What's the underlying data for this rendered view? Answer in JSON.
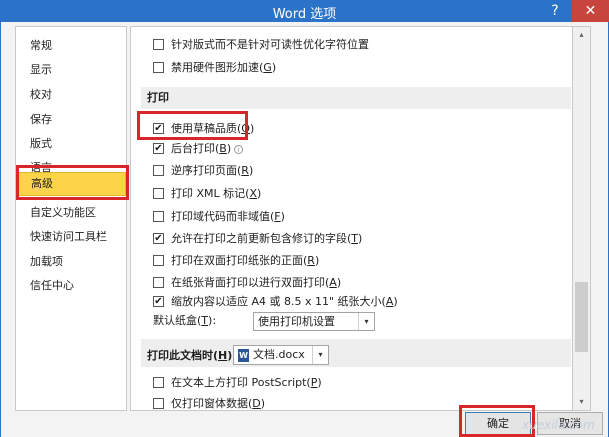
{
  "window": {
    "title": "Word 选项",
    "help_glyph": "?",
    "close_glyph": "✕"
  },
  "sidebar": {
    "items": [
      {
        "label": "常规"
      },
      {
        "label": "显示"
      },
      {
        "label": "校对"
      },
      {
        "label": "保存"
      },
      {
        "label": "版式"
      },
      {
        "label": "语言"
      },
      {
        "label": "高级",
        "selected": true
      },
      {
        "label": "自定义功能区"
      },
      {
        "label": "快速访问工具栏"
      },
      {
        "label": "加载项"
      },
      {
        "label": "信任中心"
      }
    ]
  },
  "options_top": [
    {
      "text": "针对版式而不是针对可读性优化字符位置",
      "checked": false
    },
    {
      "text": "禁用硬件图形加速(",
      "key": "G",
      "suffix": ")",
      "checked": false
    }
  ],
  "print_section": {
    "header": "打印",
    "options": [
      {
        "text": "使用草稿品质(",
        "key": "Q",
        "suffix": ")",
        "checked": true
      },
      {
        "text": "后台打印(",
        "key": "B",
        "suffix": ")",
        "checked": true,
        "info": true
      },
      {
        "text": "逆序打印页面(",
        "key": "R",
        "suffix": ")",
        "checked": false
      },
      {
        "text": "打印 XML 标记(",
        "key": "X",
        "suffix": ")",
        "checked": false
      },
      {
        "text": "打印域代码而非域值(",
        "key": "F",
        "suffix": ")",
        "checked": false
      },
      {
        "text": "允许在打印之前更新包含修订的字段(",
        "key": "T",
        "suffix": ")",
        "checked": true
      },
      {
        "text": "打印在双面打印纸张的正面(",
        "key": "R",
        "suffix": ")",
        "checked": false
      },
      {
        "text": "在纸张背面打印以进行双面打印(",
        "key": "A",
        "suffix": ")",
        "checked": false
      },
      {
        "text": "缩放内容以适应 A4 或 8.5 x 11\" 纸张大小(",
        "key": "A",
        "suffix": ")",
        "checked": true
      }
    ],
    "tray_label_pre": "默认纸盒(",
    "tray_label_key": "T",
    "tray_label_post": "):",
    "tray_value": "使用打印机设置"
  },
  "print_doc_section": {
    "label": "打印此文档时(",
    "label_key": "H",
    "label_suffix": "):",
    "doc_value": "文档.docx",
    "doc_icon": "W",
    "options": [
      {
        "text": "在文本上方打印 PostScript(",
        "key": "P",
        "suffix": ")",
        "checked": false
      },
      {
        "text": "仅打印窗体数据(",
        "key": "D",
        "suffix": ")",
        "checked": false
      }
    ]
  },
  "buttons": {
    "ok": "确定",
    "cancel": "取消"
  },
  "watermark": "xuexila.com",
  "glyphs": {
    "check": "✔",
    "arrow_down": "▾",
    "arrow_up": "▴",
    "info": "i"
  },
  "colors": {
    "title_bar": "#2b73c9",
    "selected": "#fbd44a",
    "highlight": "#d9262b",
    "close": "#c7453c"
  }
}
